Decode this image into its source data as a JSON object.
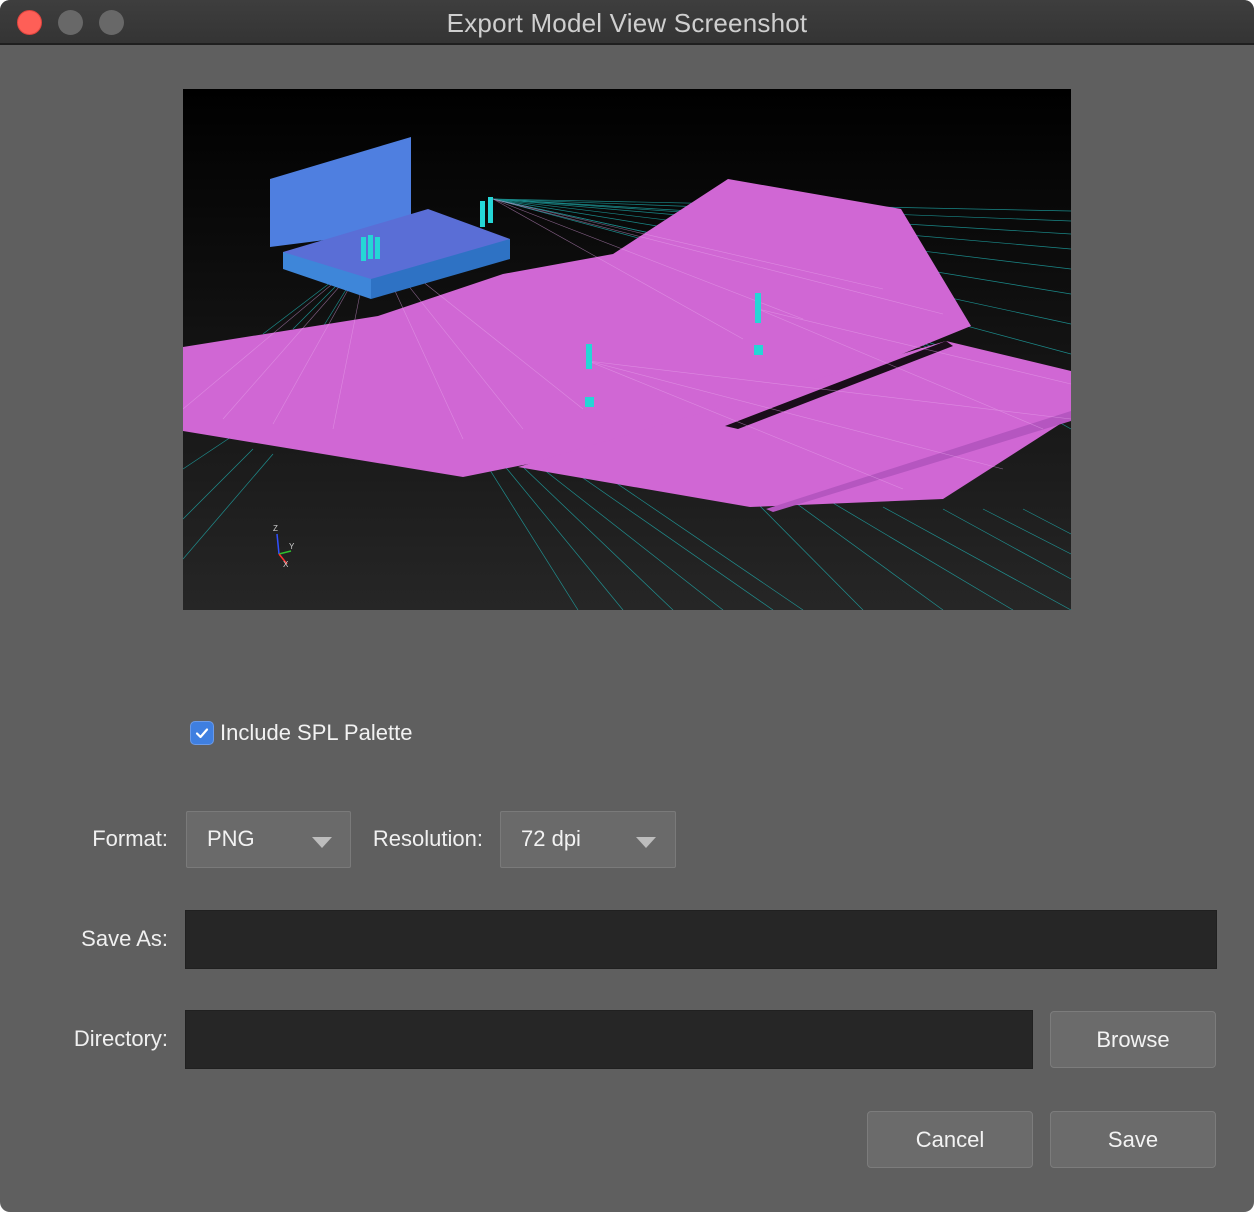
{
  "window": {
    "title": "Export Model View Screenshot"
  },
  "options": {
    "include_palette_label": "Include SPL Palette",
    "include_palette_checked": true
  },
  "format": {
    "label": "Format:",
    "value": "PNG"
  },
  "resolution": {
    "label": "Resolution:",
    "value": "72 dpi"
  },
  "save_as": {
    "label": "Save As:",
    "value": ""
  },
  "directory": {
    "label": "Directory:",
    "value": "",
    "browse_label": "Browse"
  },
  "actions": {
    "cancel_label": "Cancel",
    "save_label": "Save"
  },
  "preview": {
    "axis_labels": [
      "Z",
      "Y",
      "X"
    ]
  },
  "colors": {
    "close": "#fe5f57",
    "accent": "#3f7fe0",
    "audience_plane": "#d067d4",
    "stage": "#4f7fe0",
    "speaker": "#25d6d6"
  }
}
